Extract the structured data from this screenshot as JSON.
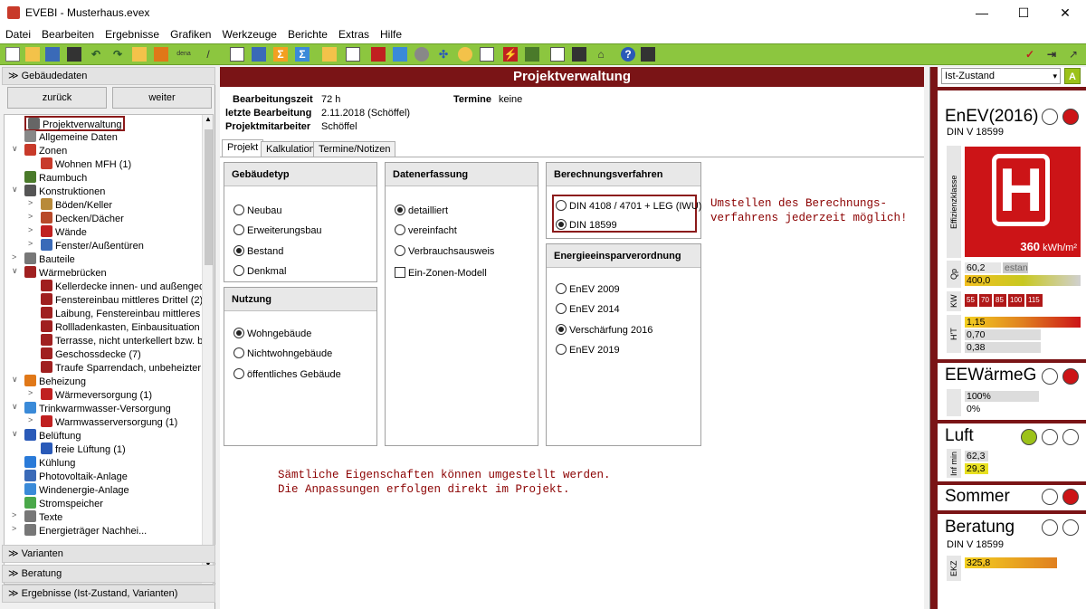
{
  "window": {
    "app": "EVEBI",
    "title": "EVEBI - Musterhaus.evex",
    "min": "—",
    "max": "☐",
    "close": "✕"
  },
  "menu": [
    "Datei",
    "Bearbeiten",
    "Ergebnisse",
    "Grafiken",
    "Werkzeuge",
    "Berichte",
    "Extras",
    "Hilfe"
  ],
  "toolbar": {
    "dena_label": "dena"
  },
  "left": {
    "header": "Gebäudedaten",
    "back": "zurück",
    "forward": "weiter",
    "tree": [
      {
        "label": "Projektverwaltung",
        "icon": "gear-icon",
        "color": "#666"
      },
      {
        "label": "Allgemeine Daten",
        "icon": "house-icon",
        "color": "#888"
      },
      {
        "label": "Zonen",
        "icon": "zone-icon",
        "color": "#c83a2a"
      },
      {
        "label": "Wohnen MFH (1)",
        "icon": "house-icon",
        "color": "#c83a2a"
      },
      {
        "label": "Raumbuch",
        "icon": "book-icon",
        "color": "#4a7a2a"
      },
      {
        "label": "Konstruktionen",
        "icon": "construction-icon",
        "color": "#555"
      },
      {
        "label": "Böden/Keller",
        "icon": "floor-icon",
        "color": "#b88a3a"
      },
      {
        "label": "Decken/Dächer",
        "icon": "roof-icon",
        "color": "#b84a2a"
      },
      {
        "label": "Wände",
        "icon": "wall-icon",
        "color": "#c02020"
      },
      {
        "label": "Fenster/Außentüren",
        "icon": "window-icon",
        "color": "#3a6ab8"
      },
      {
        "label": "Bauteile",
        "icon": "component-icon",
        "color": "#777"
      },
      {
        "label": "Wärmebrücken",
        "icon": "bridge-icon",
        "color": "#a02020"
      },
      {
        "label": "Kellerdecke innen- und außengedä",
        "icon": "bridge-icon",
        "color": "#a02020"
      },
      {
        "label": "Fenstereinbau mittleres Drittel (2)",
        "icon": "bridge-icon",
        "color": "#a02020"
      },
      {
        "label": "Laibung, Fenstereinbau mittleres D",
        "icon": "bridge-icon",
        "color": "#a02020"
      },
      {
        "label": "Rollladenkasten, Einbausituation mi",
        "icon": "bridge-icon",
        "color": "#a02020"
      },
      {
        "label": "Terrasse, nicht unterkellert bzw. be",
        "icon": "bridge-icon",
        "color": "#a02020"
      },
      {
        "label": "Geschossdecke (7)",
        "icon": "bridge-icon",
        "color": "#a02020"
      },
      {
        "label": "Traufe Sparrendach, unbeheizter D",
        "icon": "bridge-icon",
        "color": "#a02020"
      },
      {
        "label": "Beheizung",
        "icon": "flame-icon",
        "color": "#e07818"
      },
      {
        "label": "Wärmeversorgung (1)",
        "icon": "heater-icon",
        "color": "#c02020"
      },
      {
        "label": "Trinkwarmwasser-Versorgung",
        "icon": "drop-icon",
        "color": "#3a8ad8"
      },
      {
        "label": "Warmwasserversorgung (1)",
        "icon": "heater-icon",
        "color": "#c02020"
      },
      {
        "label": "Belüftung",
        "icon": "fan-icon",
        "color": "#2a5ab8"
      },
      {
        "label": "freie Lüftung (1)",
        "icon": "fan-icon",
        "color": "#2a5ab8"
      },
      {
        "label": "Kühlung",
        "icon": "snowflake-icon",
        "color": "#2a7ad8"
      },
      {
        "label": "Photovoltaik-Anlage",
        "icon": "solar-icon",
        "color": "#3a6ab8"
      },
      {
        "label": "Windenergie-Anlage",
        "icon": "wind-icon",
        "color": "#3a8ad8"
      },
      {
        "label": "Stromspeicher",
        "icon": "battery-icon",
        "color": "#4aa84a"
      },
      {
        "label": "Texte",
        "icon": "text-icon",
        "color": "#777"
      },
      {
        "label": "Energieträger Nachhei...",
        "icon": "energy-icon",
        "color": "#777"
      }
    ],
    "sections": [
      "Varianten",
      "Beratung",
      "Ergebnisse (Ist-Zustand, Varianten)"
    ]
  },
  "center": {
    "title": "Projektverwaltung",
    "info": {
      "bearbeitungszeit_label": "Bearbeitungszeit",
      "bearbeitungszeit": "72 h",
      "letzte_label": "letzte Bearbeitung",
      "letzte": "2.11.2018 (Schöffel)",
      "mitarbeiter_label": "Projektmitarbeiter",
      "mitarbeiter": "Schöffel",
      "termine_label": "Termine",
      "termine": "keine"
    },
    "tabs": [
      "Projekt",
      "Kalkulation",
      "Termine/Notizen"
    ],
    "gebaeudetyp": {
      "title": "Gebäudetyp",
      "options": [
        "Neubau",
        "Erweiterungsbau",
        "Bestand",
        "Denkmal"
      ]
    },
    "nutzung": {
      "title": "Nutzung",
      "options": [
        "Wohngebäude",
        "Nichtwohngebäude",
        "öffentliches Gebäude"
      ]
    },
    "datenerfassung": {
      "title": "Datenerfassung",
      "options": [
        "detailliert",
        "vereinfacht",
        "Verbrauchsausweis"
      ],
      "checkbox": "Ein-Zonen-Modell"
    },
    "berechnung": {
      "title": "Berechnungsverfahren",
      "options": [
        "DIN 4108 / 4701 + LEG (IWU)",
        "DIN 18599"
      ]
    },
    "enev": {
      "title": "Energieeinsparverordnung",
      "options": [
        "EnEV 2009",
        "EnEV 2014",
        "Verschärfung 2016",
        "EnEV 2019"
      ]
    },
    "note1_line1": "Umstellen des Berechnungs-",
    "note1_line2": "verfahrens jederzeit möglich!",
    "note2_line1": "Sämtliche Eigenschaften können umgestellt werden.",
    "note2_line2": "Die Anpassungen erfolgen direkt im Projekt."
  },
  "right": {
    "dropdown": "Ist-Zustand",
    "a_button": "A",
    "enev_title": "EnEV(2016)",
    "enev_sub": "DIN V 18599",
    "effizienz_label": "Effizienzklasse",
    "klasse": "H",
    "kwh_value": "360",
    "kwh_unit": "kWh/m²",
    "qp_label": "Qp",
    "qp_value": "60,2",
    "qp_tag": "estan",
    "qp_ref": "400,0",
    "kw_label": "KW",
    "kw_values": [
      "55",
      "70",
      "85",
      "100",
      "115"
    ],
    "ht_label": "H'T",
    "ht_values": [
      "1,15",
      "0,70",
      "0,38"
    ],
    "ee_title": "EEWärmeG",
    "ee_values": [
      "100%",
      "0%"
    ],
    "luft_title": "Luft",
    "inf_label": "Inf min",
    "luft_values": [
      "62,3",
      "29,3"
    ],
    "sommer_title": "Sommer",
    "beratung_title": "Beratung",
    "beratung_sub": "DIN V 18599",
    "ekz_label": "EKZ",
    "ekz_value": "325,8",
    "colors": {
      "accent": "#7a1416",
      "red": "#cc1417",
      "green": "#9cc219",
      "toolbar": "#8cc63f"
    }
  }
}
